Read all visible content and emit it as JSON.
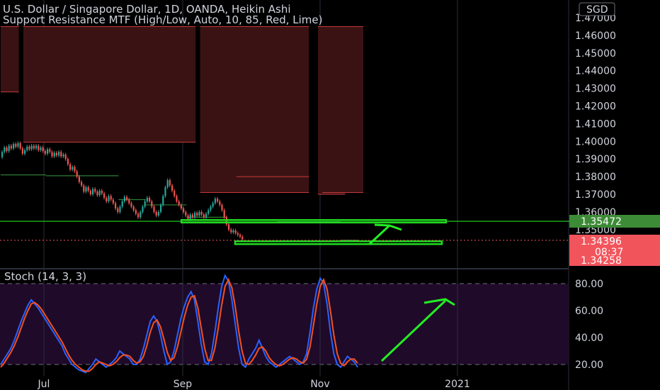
{
  "header": {
    "symbol_line": "U.S. Dollar / Singapore Dollar, 1D, OANDA, Heikin Ashi",
    "indicator_line": "Support Resistance MTF (High/Low, Auto, 10, 85, Red, Lime)",
    "currency_badge": "SGD"
  },
  "price_labels": {
    "resistance": "1.35472",
    "current": "1.34396",
    "countdown": "08:37",
    "support": "1.34258"
  },
  "colors": {
    "up": "#26a69a",
    "down": "#ef5350",
    "resistance_zone": "#3a1214",
    "support_line": "#22dd22",
    "stoch_k": "#2962ff",
    "stoch_d": "#f4511e",
    "stoch_band": "#1f0a2a",
    "arrow": "#22ee22"
  },
  "stoch": {
    "title": "Stoch (14, 3, 3)",
    "ticks": [
      "80.00",
      "60.00",
      "40.00",
      "20.00"
    ],
    "upper": 80,
    "lower": 20
  },
  "chart_data": [
    {
      "type": "candlestick",
      "title": "U.S. Dollar / Singapore Dollar, 1D, OANDA, Heikin Ashi",
      "y_ticks": [
        "1.47000",
        "1.46000",
        "1.45000",
        "1.44000",
        "1.43000",
        "1.42000",
        "1.41000",
        "1.40000",
        "1.39000",
        "1.38000",
        "1.37000",
        "1.36000",
        "1.35000"
      ],
      "ylim": [
        1.343,
        1.4705
      ],
      "x_labels": [
        "Jul",
        "Sep",
        "Nov",
        "2021"
      ],
      "candles": [
        {
          "o": 1.391,
          "c": 1.394
        },
        {
          "o": 1.394,
          "c": 1.3965
        },
        {
          "o": 1.3965,
          "c": 1.3945
        },
        {
          "o": 1.3945,
          "c": 1.3975
        },
        {
          "o": 1.3975,
          "c": 1.396
        },
        {
          "o": 1.396,
          "c": 1.3985
        },
        {
          "o": 1.3985,
          "c": 1.397
        },
        {
          "o": 1.397,
          "c": 1.399
        },
        {
          "o": 1.399,
          "c": 1.396
        },
        {
          "o": 1.396,
          "c": 1.393
        },
        {
          "o": 1.393,
          "c": 1.395
        },
        {
          "o": 1.395,
          "c": 1.397
        },
        {
          "o": 1.397,
          "c": 1.3955
        },
        {
          "o": 1.3955,
          "c": 1.3975
        },
        {
          "o": 1.3975,
          "c": 1.396
        },
        {
          "o": 1.396,
          "c": 1.3975
        },
        {
          "o": 1.3975,
          "c": 1.395
        },
        {
          "o": 1.395,
          "c": 1.3965
        },
        {
          "o": 1.3965,
          "c": 1.3945
        },
        {
          "o": 1.3945,
          "c": 1.393
        },
        {
          "o": 1.393,
          "c": 1.3955
        },
        {
          "o": 1.3955,
          "c": 1.394
        },
        {
          "o": 1.394,
          "c": 1.3915
        },
        {
          "o": 1.3915,
          "c": 1.3935
        },
        {
          "o": 1.3935,
          "c": 1.392
        },
        {
          "o": 1.392,
          "c": 1.394
        },
        {
          "o": 1.394,
          "c": 1.3915
        },
        {
          "o": 1.3915,
          "c": 1.3925
        },
        {
          "o": 1.3925,
          "c": 1.39
        },
        {
          "o": 1.39,
          "c": 1.387
        },
        {
          "o": 1.387,
          "c": 1.384
        },
        {
          "o": 1.384,
          "c": 1.3855
        },
        {
          "o": 1.3855,
          "c": 1.383
        },
        {
          "o": 1.383,
          "c": 1.38
        },
        {
          "o": 1.38,
          "c": 1.377
        },
        {
          "o": 1.377,
          "c": 1.375
        },
        {
          "o": 1.375,
          "c": 1.3715
        },
        {
          "o": 1.3715,
          "c": 1.374
        },
        {
          "o": 1.374,
          "c": 1.372
        },
        {
          "o": 1.372,
          "c": 1.37
        },
        {
          "o": 1.37,
          "c": 1.373
        },
        {
          "o": 1.373,
          "c": 1.3715
        },
        {
          "o": 1.3715,
          "c": 1.3695
        },
        {
          "o": 1.3695,
          "c": 1.372
        },
        {
          "o": 1.372,
          "c": 1.3705
        },
        {
          "o": 1.3705,
          "c": 1.368
        },
        {
          "o": 1.368,
          "c": 1.366
        },
        {
          "o": 1.366,
          "c": 1.369
        },
        {
          "o": 1.369,
          "c": 1.367
        },
        {
          "o": 1.367,
          "c": 1.365
        },
        {
          "o": 1.365,
          "c": 1.362
        },
        {
          "o": 1.362,
          "c": 1.36
        },
        {
          "o": 1.36,
          "c": 1.363
        },
        {
          "o": 1.363,
          "c": 1.366
        },
        {
          "o": 1.366,
          "c": 1.3685
        },
        {
          "o": 1.3685,
          "c": 1.367
        },
        {
          "o": 1.367,
          "c": 1.365
        },
        {
          "o": 1.365,
          "c": 1.363
        },
        {
          "o": 1.363,
          "c": 1.361
        },
        {
          "o": 1.361,
          "c": 1.359
        },
        {
          "o": 1.359,
          "c": 1.357
        },
        {
          "o": 1.357,
          "c": 1.36
        },
        {
          "o": 1.36,
          "c": 1.363
        },
        {
          "o": 1.363,
          "c": 1.366
        },
        {
          "o": 1.366,
          "c": 1.368
        },
        {
          "o": 1.368,
          "c": 1.366
        },
        {
          "o": 1.366,
          "c": 1.363
        },
        {
          "o": 1.363,
          "c": 1.36
        },
        {
          "o": 1.36,
          "c": 1.358
        },
        {
          "o": 1.358,
          "c": 1.36
        },
        {
          "o": 1.36,
          "c": 1.364
        },
        {
          "o": 1.364,
          "c": 1.369
        },
        {
          "o": 1.369,
          "c": 1.374
        },
        {
          "o": 1.374,
          "c": 1.378
        },
        {
          "o": 1.378,
          "c": 1.375
        },
        {
          "o": 1.375,
          "c": 1.372
        },
        {
          "o": 1.372,
          "c": 1.369
        },
        {
          "o": 1.369,
          "c": 1.366
        },
        {
          "o": 1.366,
          "c": 1.364
        },
        {
          "o": 1.364,
          "c": 1.362
        },
        {
          "o": 1.362,
          "c": 1.36
        },
        {
          "o": 1.36,
          "c": 1.358
        },
        {
          "o": 1.358,
          "c": 1.356
        },
        {
          "o": 1.356,
          "c": 1.3585
        },
        {
          "o": 1.3585,
          "c": 1.357
        },
        {
          "o": 1.357,
          "c": 1.3595
        },
        {
          "o": 1.3595,
          "c": 1.358
        },
        {
          "o": 1.358,
          "c": 1.36
        },
        {
          "o": 1.36,
          "c": 1.3585
        },
        {
          "o": 1.3585,
          "c": 1.357
        },
        {
          "o": 1.357,
          "c": 1.359
        },
        {
          "o": 1.359,
          "c": 1.361
        },
        {
          "o": 1.361,
          "c": 1.363
        },
        {
          "o": 1.363,
          "c": 1.365
        },
        {
          "o": 1.365,
          "c": 1.3675
        },
        {
          "o": 1.3675,
          "c": 1.366
        },
        {
          "o": 1.366,
          "c": 1.364
        },
        {
          "o": 1.364,
          "c": 1.361
        },
        {
          "o": 1.361,
          "c": 1.357
        },
        {
          "o": 1.357,
          "c": 1.353
        },
        {
          "o": 1.353,
          "c": 1.35
        },
        {
          "o": 1.35,
          "c": 1.3485
        },
        {
          "o": 1.3485,
          "c": 1.3495
        },
        {
          "o": 1.3495,
          "c": 1.348
        },
        {
          "o": 1.348,
          "c": 1.347
        },
        {
          "o": 1.347,
          "c": 1.346
        },
        {
          "o": 1.346,
          "c": 1.3445
        }
      ],
      "resistance_zones": [
        {
          "from": 0,
          "to": 8,
          "top": 1.465,
          "bottom": 1.428
        },
        {
          "from": 10,
          "to": 86,
          "top": 1.465,
          "bottom": 1.3995
        },
        {
          "from": 88,
          "to": 136,
          "top": 1.465,
          "bottom": 1.371
        },
        {
          "from": 104,
          "to": 136,
          "top": 1.465,
          "bottom": 1.38
        },
        {
          "from": 140,
          "to": 152,
          "top": 1.465,
          "bottom": 1.37
        },
        {
          "from": 142,
          "to": 160,
          "top": 1.465,
          "bottom": 1.371
        }
      ],
      "support_steps": [
        {
          "from": 0,
          "to": 20,
          "price": 1.381
        },
        {
          "from": 20,
          "to": 52,
          "price": 1.3805
        },
        {
          "from": 52,
          "to": 64,
          "price": 1.367
        },
        {
          "from": 64,
          "to": 82,
          "price": 1.364
        },
        {
          "from": 82,
          "to": 100,
          "price": 1.357
        },
        {
          "from": 100,
          "to": 122,
          "price": 1.3555
        },
        {
          "from": 122,
          "to": 150,
          "price": 1.3545
        },
        {
          "from": 150,
          "to": 158,
          "price": 1.344
        }
      ],
      "resistance_line": 1.35472,
      "support_line": 1.34258,
      "current_price": 1.34396
    },
    {
      "type": "line",
      "title": "Stoch (14, 3, 3)",
      "ylim": [
        0,
        100
      ],
      "series": [
        {
          "values": [
            20,
            24,
            28,
            32,
            38,
            45,
            52,
            58,
            64,
            68,
            65,
            62,
            58,
            54,
            50,
            46,
            42,
            38,
            34,
            28,
            24,
            20,
            18,
            16,
            15,
            14,
            17,
            20,
            24,
            22,
            20,
            18,
            20,
            22,
            25,
            30,
            28,
            26,
            24,
            20,
            20,
            24,
            32,
            42,
            52,
            56,
            52,
            42,
            30,
            20,
            22,
            30,
            42,
            54,
            63,
            70,
            74,
            68,
            52,
            35,
            22,
            20,
            28,
            44,
            62,
            78,
            86,
            82,
            68,
            50,
            32,
            20,
            18,
            24,
            28,
            32,
            38,
            32,
            26,
            22,
            20,
            18,
            20,
            22,
            24,
            26,
            24,
            22,
            20,
            22,
            28,
            44,
            62,
            76,
            84,
            80,
            65,
            44,
            28,
            20,
            18,
            22,
            26,
            24,
            22,
            18
          ]
        },
        {
          "values": [
            18,
            21,
            25,
            29,
            34,
            40,
            47,
            54,
            60,
            65,
            66,
            64,
            61,
            57,
            53,
            49,
            45,
            41,
            37,
            32,
            27,
            23,
            20,
            18,
            16,
            15,
            15,
            17,
            20,
            22,
            21,
            20,
            19,
            20,
            22,
            25,
            27,
            27,
            26,
            23,
            21,
            22,
            26,
            34,
            44,
            51,
            53,
            48,
            39,
            29,
            23,
            25,
            33,
            44,
            55,
            64,
            70,
            71,
            62,
            47,
            32,
            23,
            23,
            32,
            47,
            64,
            78,
            83,
            77,
            63,
            45,
            30,
            21,
            20,
            23,
            27,
            32,
            33,
            30,
            25,
            22,
            20,
            19,
            20,
            22,
            24,
            25,
            24,
            22,
            21,
            24,
            33,
            49,
            65,
            78,
            83,
            76,
            60,
            42,
            28,
            21,
            19,
            22,
            24,
            24,
            21
          ]
        }
      ]
    }
  ]
}
